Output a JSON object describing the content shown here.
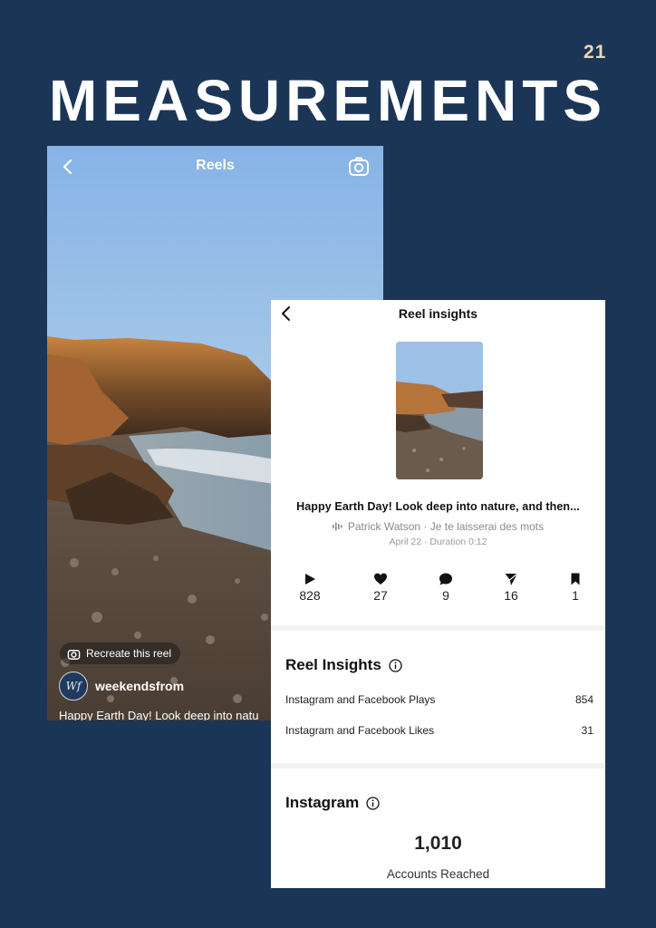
{
  "page": {
    "number": "21",
    "title": "MEASUREMENTS"
  },
  "reel_screen": {
    "title": "Reels",
    "recreate_label": "Recreate this reel",
    "avatar_text": "Wf",
    "username": "weekendsfrom",
    "caption": "Happy Earth Day! Look deep into natu"
  },
  "insights": {
    "header_title": "Reel insights",
    "caption": "Happy Earth Day! Look deep into nature, and then...",
    "audio": "Patrick Watson · Je te laisserai des mots",
    "date": "April 22 · Duration 0:12",
    "metrics": [
      {
        "icon": "play-icon",
        "value": "828"
      },
      {
        "icon": "heart-icon",
        "value": "27"
      },
      {
        "icon": "comment-icon",
        "value": "9"
      },
      {
        "icon": "share-icon",
        "value": "16"
      },
      {
        "icon": "bookmark-icon",
        "value": "1"
      }
    ],
    "reel_insights": {
      "title": "Reel Insights",
      "rows": [
        {
          "label": "Instagram and Facebook Plays",
          "value": "854"
        },
        {
          "label": "Instagram and Facebook Likes",
          "value": "31"
        }
      ]
    },
    "instagram": {
      "title": "Instagram",
      "accounts_reached": "1,010",
      "accounts_reached_label": "Accounts Reached"
    }
  },
  "colors": {
    "background": "#1b3556",
    "page_number": "#e9d9b5",
    "title": "#ffffff"
  }
}
